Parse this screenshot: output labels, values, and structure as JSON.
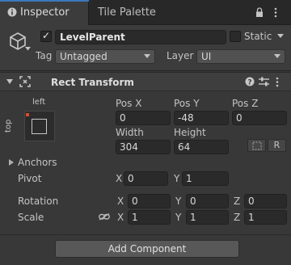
{
  "tabs": [
    {
      "label": "Inspector",
      "icon": "info-icon"
    },
    {
      "label": "Tile Palette"
    }
  ],
  "object": {
    "name": "LevelParent",
    "active": true,
    "static_label": "Static",
    "static_checked": false,
    "tag_label": "Tag",
    "tag_value": "Untagged",
    "layer_label": "Layer",
    "layer_value": "UI"
  },
  "rect_transform": {
    "title": "Rect Transform",
    "anchor_preset": {
      "horizontal": "left",
      "vertical": "top"
    },
    "fields": {
      "pos_x": {
        "label": "Pos X",
        "value": "0"
      },
      "pos_y": {
        "label": "Pos Y",
        "value": "-48"
      },
      "pos_z": {
        "label": "Pos Z",
        "value": "0"
      },
      "width": {
        "label": "Width",
        "value": "304"
      },
      "height": {
        "label": "Height",
        "value": "64"
      }
    },
    "raw_button": "R",
    "anchors_label": "Anchors",
    "pivot": {
      "label": "Pivot",
      "x_label": "X",
      "x": "0",
      "y_label": "Y",
      "y": "1"
    },
    "rotation": {
      "label": "Rotation",
      "x_label": "X",
      "x": "0",
      "y_label": "Y",
      "y": "0",
      "z_label": "Z",
      "z": "0"
    },
    "scale": {
      "label": "Scale",
      "x_label": "X",
      "x": "1",
      "y_label": "Y",
      "y": "1",
      "z_label": "Z",
      "z": "1"
    }
  },
  "add_component": "Add Component",
  "colors": {
    "accent": "#3a79bb",
    "panel": "#383838",
    "field": "#2a2a2a"
  }
}
